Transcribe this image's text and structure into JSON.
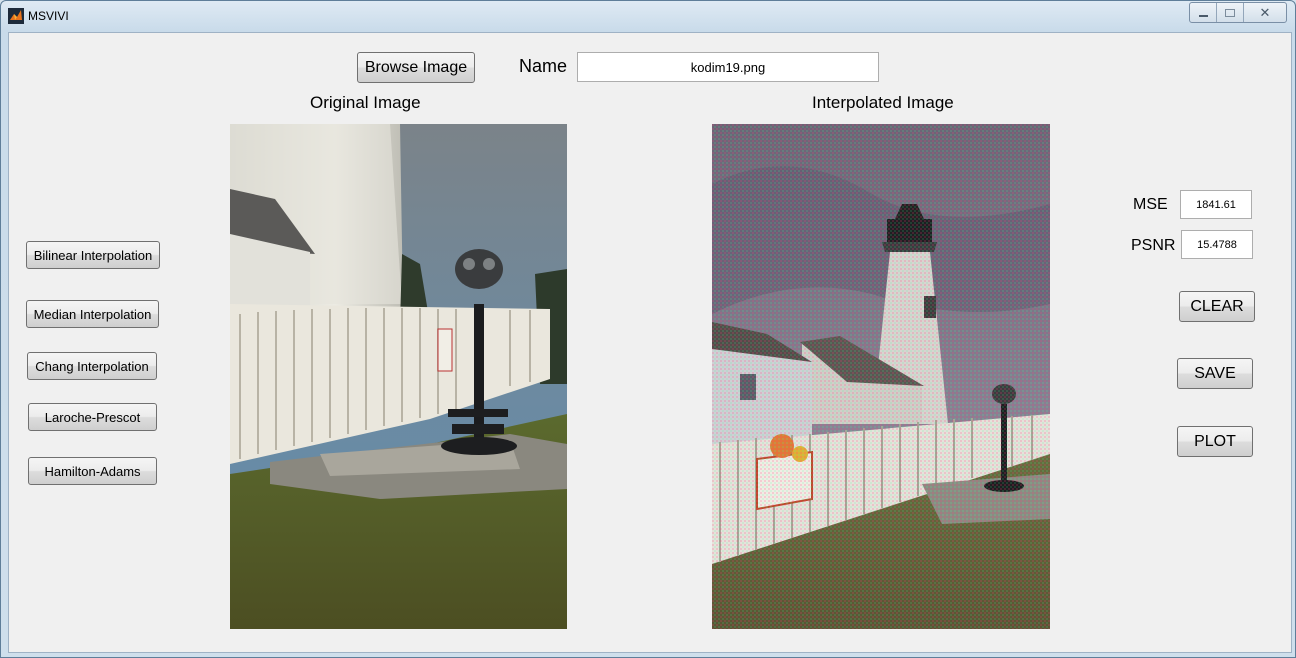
{
  "window": {
    "title": "MSVIVI",
    "controls": {
      "minimize": "minimize-icon",
      "maximize": "maximize-icon",
      "close": "close-icon"
    }
  },
  "toolbar": {
    "browse_label": "Browse Image",
    "name_label": "Name",
    "name_value": "kodim19.png"
  },
  "panels": {
    "original_title": "Original Image",
    "interpolated_title": "Interpolated Image"
  },
  "methods": [
    {
      "label": "Bilinear Interpolation"
    },
    {
      "label": "Median Interpolation"
    },
    {
      "label": "Chang Interpolation"
    },
    {
      "label": "Laroche-Prescot"
    },
    {
      "label": "Hamilton-Adams"
    }
  ],
  "metrics": {
    "mse_label": "MSE",
    "mse_value": "1841.61",
    "psnr_label": "PSNR",
    "psnr_value": "15.4788"
  },
  "actions": {
    "clear_label": "CLEAR",
    "save_label": "SAVE",
    "plot_label": "PLOT"
  }
}
